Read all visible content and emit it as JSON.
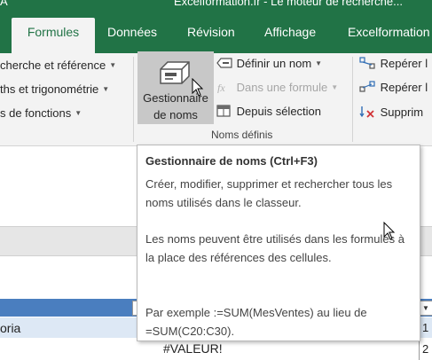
{
  "window": {
    "title": "Excelformation.fr - Le moteur de recherche..."
  },
  "tabs": [
    {
      "label": "Formules",
      "active": true
    },
    {
      "label": "Données"
    },
    {
      "label": "Révision"
    },
    {
      "label": "Affichage"
    },
    {
      "label": "Excelformation"
    }
  ],
  "ribbon": {
    "left_items": [
      {
        "label": "cherche et référence",
        "has_dropdown": true
      },
      {
        "label": "ths et trigonométrie",
        "has_dropdown": true
      },
      {
        "label": "s de fonctions",
        "has_dropdown": true
      }
    ],
    "name_manager": {
      "line1": "Gestionnaire",
      "line2": "de noms"
    },
    "define_items": [
      {
        "label": "Définir un nom",
        "has_dropdown": true,
        "enabled": true
      },
      {
        "label": "Dans une formule",
        "has_dropdown": true,
        "enabled": false
      },
      {
        "label": "Depuis sélection",
        "enabled": true
      }
    ],
    "group_label": "Noms définis",
    "audit_items": [
      {
        "label": "Repérer l"
      },
      {
        "label": "Repérer l"
      },
      {
        "label": "Supprim"
      }
    ]
  },
  "tooltip": {
    "title": "Gestionnaire de noms (Ctrl+F3)",
    "para1": "Créer, modifier, supprimer et rechercher tous les noms utilisés dans le classeur.",
    "para2": "Les noms peuvent être utilisés dans les formules à la place des références des cellules.",
    "para3": "Par exemple :=SUM(MesVentes) au lieu de =SUM(C20:C30)."
  },
  "sheet": {
    "row_left_text": "oria",
    "error_value": "#VALEUR!",
    "row_numbers": [
      "1",
      "2"
    ]
  },
  "colors": {
    "accent": "#217346",
    "table_header": "#4a7ebf",
    "row_highlight": "#dde8f5"
  }
}
